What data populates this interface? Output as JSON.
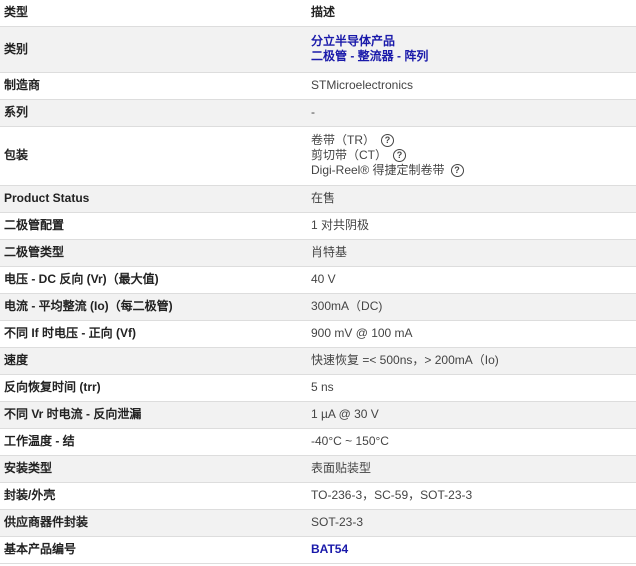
{
  "header": {
    "attribute": "类型",
    "description": "描述"
  },
  "rows": [
    {
      "label": "类别",
      "lines": [
        "分立半导体产品",
        "二极管 - 整流器 - 阵列"
      ]
    },
    {
      "label": "制造商",
      "value": "STMicroelectronics"
    },
    {
      "label": "系列",
      "value": "-"
    },
    {
      "label": "包装",
      "lines": [
        "卷带（TR）",
        "剪切带（CT）",
        "Digi-Reel® 得捷定制卷带"
      ]
    },
    {
      "label": "Product Status",
      "value": "在售"
    },
    {
      "label": "二极管配置",
      "value": "1 对共阴极"
    },
    {
      "label": "二极管类型",
      "value": "肖特基"
    },
    {
      "label": "电压 - DC 反向 (Vr)（最大值)",
      "value": "40 V"
    },
    {
      "label": "电流 - 平均整流 (Io)（每二极管)",
      "value": "300mA（DC)"
    },
    {
      "label": "不同 If 时电压 - 正向 (Vf)",
      "value": "900 mV @ 100 mA"
    },
    {
      "label": "速度",
      "value": "快速恢复 =< 500ns，> 200mA（Io)"
    },
    {
      "label": "反向恢复时间 (trr)",
      "value": "5 ns"
    },
    {
      "label": "不同 Vr 时电流 - 反向泄漏",
      "value": "1 µA @ 30 V"
    },
    {
      "label": "工作温度 - 结",
      "value": "-40°C ~ 150°C"
    },
    {
      "label": "安装类型",
      "value": "表面贴装型"
    },
    {
      "label": "封装/外壳",
      "value": "TO-236-3，SC-59，SOT-23-3"
    },
    {
      "label": "供应商器件封装",
      "value": "SOT-23-3"
    },
    {
      "label": "基本产品编号",
      "value": "BAT54"
    }
  ],
  "icons": {
    "help": "question-circle-icon"
  },
  "colors": {
    "link": "#1a1aaa",
    "row_alt": "#f2f2f2",
    "border": "#dddddd"
  }
}
